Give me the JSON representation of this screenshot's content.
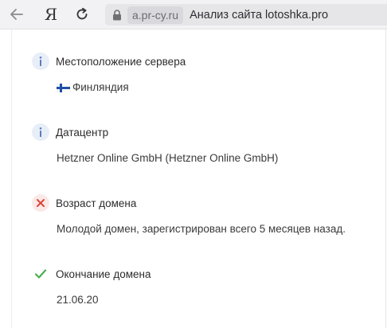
{
  "browser": {
    "domain": "a.pr-cy.ru",
    "page_title": "Анализ сайта lotoshka.pro",
    "yandex_glyph": "Я"
  },
  "colors": {
    "info": "#5b7fb5",
    "error": "#e0453a",
    "ok": "#4caf50"
  },
  "items": [
    {
      "title": "Местоположение сервера",
      "status": "info",
      "value": "Финляндия",
      "flag": "finland-flag-icon"
    },
    {
      "title": "Датацентр",
      "status": "info",
      "value": "Hetzner Online GmbH (Hetzner Online GmbH)"
    },
    {
      "title": "Возраст домена",
      "status": "error",
      "value": "Молодой домен, зарегистрирован всего 5 месяцев назад."
    },
    {
      "title": "Окончание домена",
      "status": "ok",
      "value": "21.06.20"
    }
  ]
}
